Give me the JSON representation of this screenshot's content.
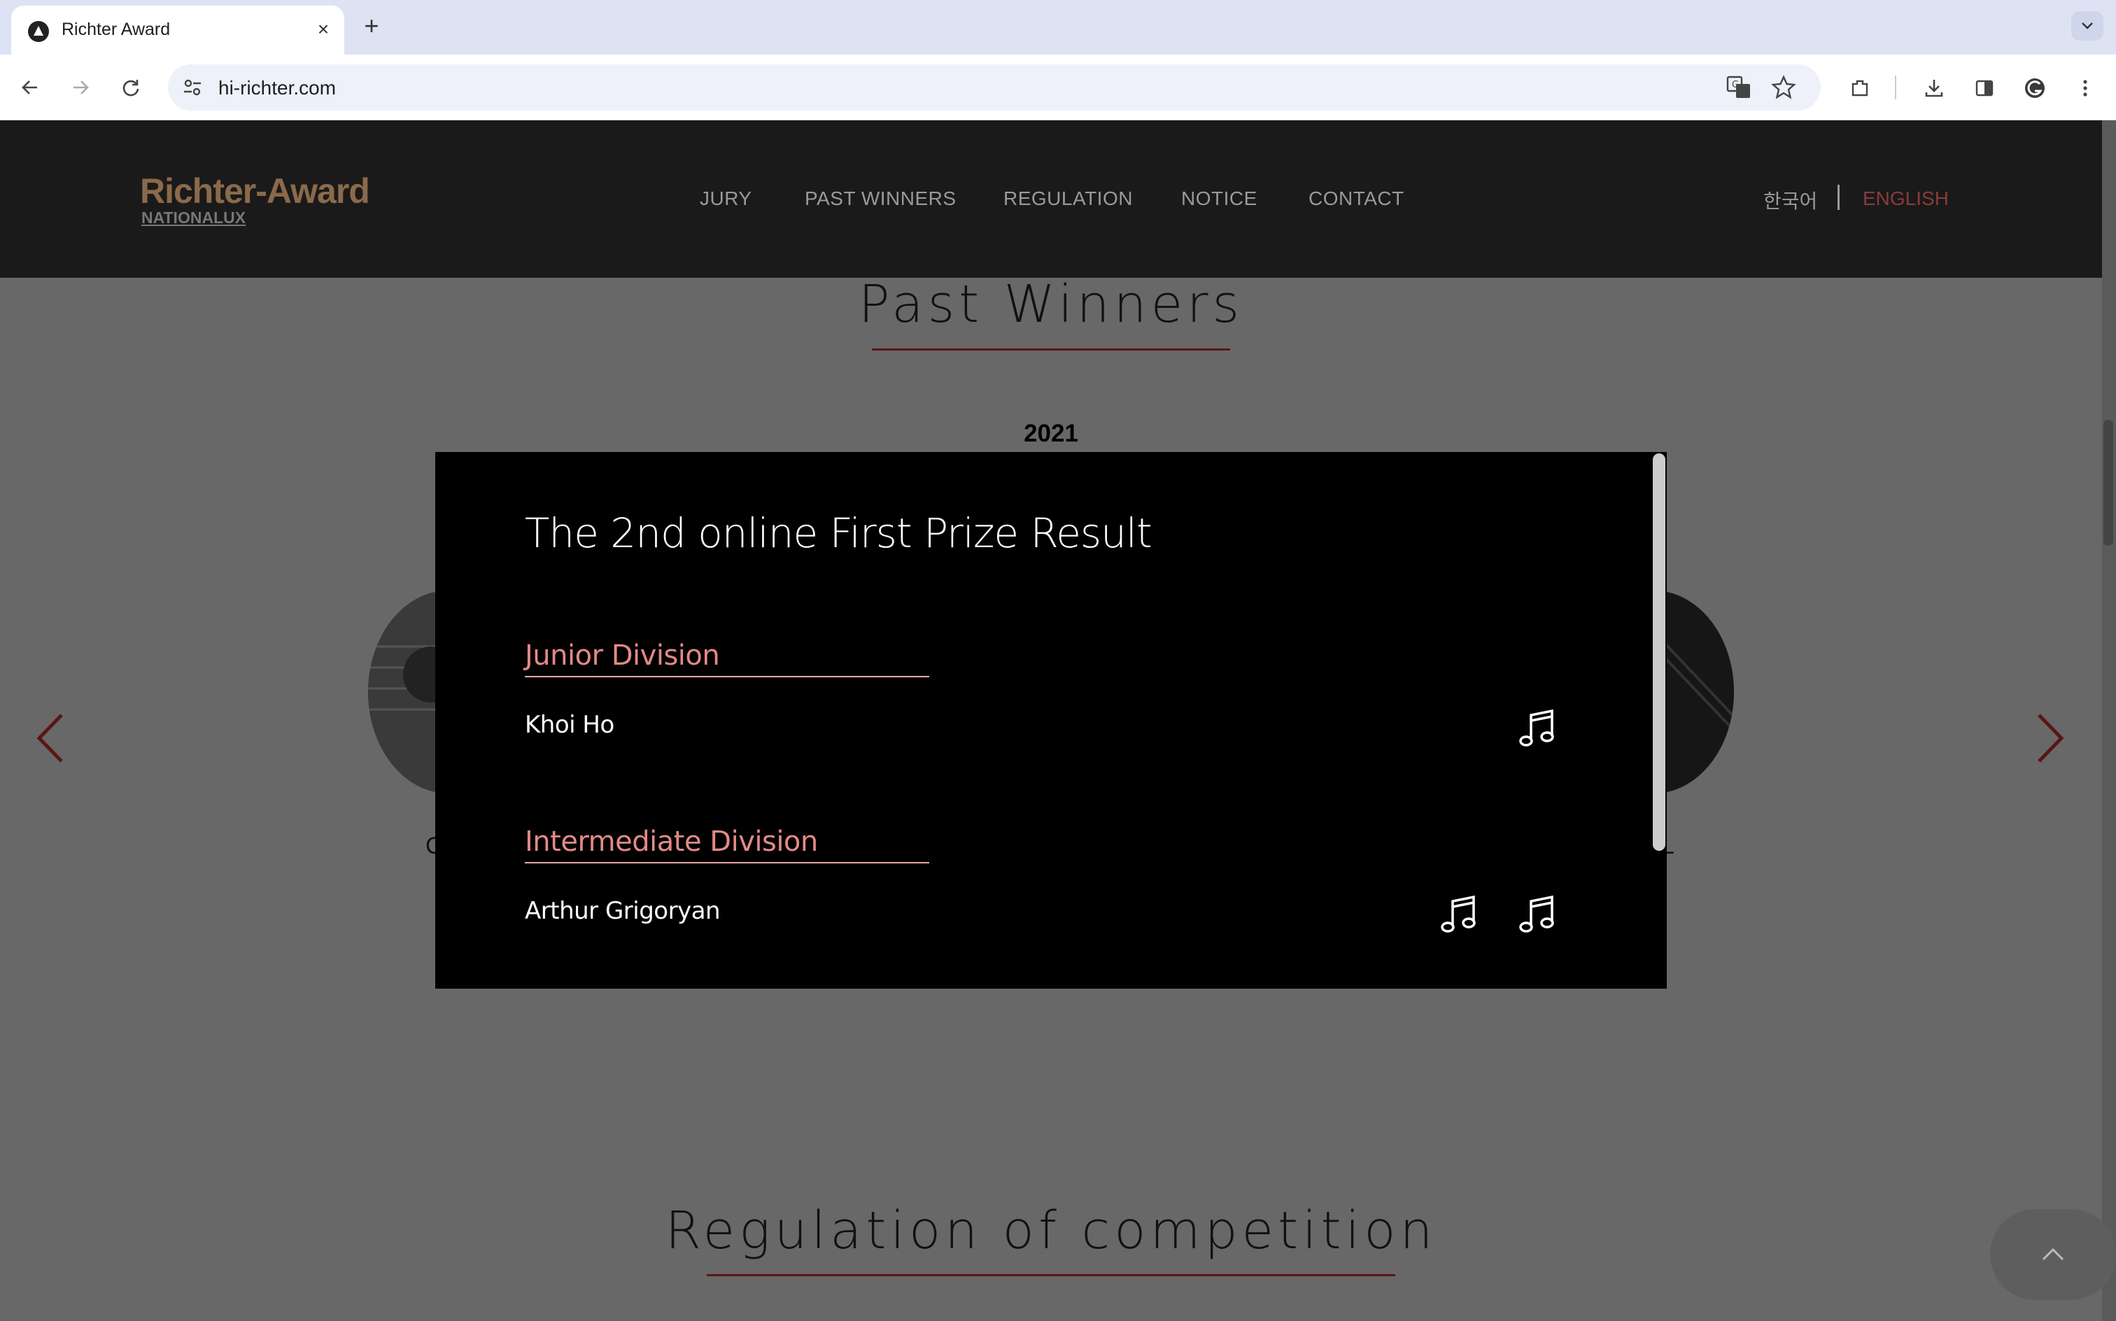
{
  "browser": {
    "tab_title": "Richter Award",
    "new_tab_label": "+",
    "close_label": "×",
    "url": "hi-richter.com"
  },
  "header": {
    "logo": "Richter-Award",
    "logo_sub": "NATIONALUX",
    "nav": [
      "JURY",
      "PAST WINNERS",
      "REGULATION",
      "NOTICE",
      "CONTACT"
    ],
    "lang_korean": "한국어",
    "lang_english": "ENGLISH",
    "accent_color": "#8c3a3a"
  },
  "past_winners": {
    "title": "Past Winners",
    "year": "2021",
    "card_left_label": "C",
    "card_right_label": "L"
  },
  "modal": {
    "title": "The 2nd online First Prize Result",
    "divisions": [
      {
        "title": "Junior Division",
        "winner": "Khoi Ho",
        "audio_count": 1
      },
      {
        "title": "Intermediate Division",
        "winner": "Arthur Grigoryan",
        "audio_count": 2
      }
    ]
  },
  "regulation": {
    "title": "Regulation of competition"
  }
}
